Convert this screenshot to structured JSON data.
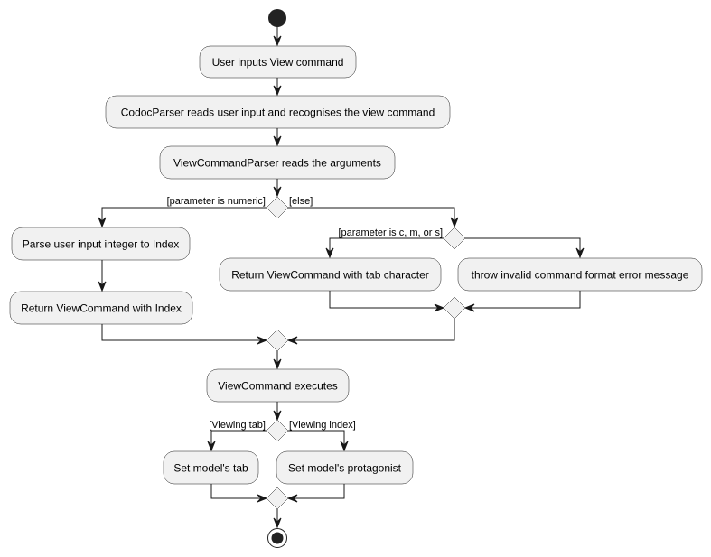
{
  "diagram": {
    "type": "activity",
    "colors": {
      "node_fill": "#F1F1F1",
      "line": "#181818",
      "start_end": "#222222",
      "background": "#FFFFFF"
    },
    "activities": {
      "user_inputs": "User inputs View command",
      "codoc_parser": "CodocParser reads user input and recognises the view command",
      "view_parser": "ViewCommandParser reads the arguments",
      "parse_int": "Parse user input integer to Index",
      "return_index": "Return ViewCommand with Index",
      "return_tab": "Return ViewCommand with tab character",
      "throw_error": "throw invalid command format error message",
      "executes": "ViewCommand executes",
      "set_tab": "Set model's tab",
      "set_protagonist": "Set model's protagonist"
    },
    "guards": {
      "numeric": "[parameter is numeric]",
      "else": "[else]",
      "cms": "[parameter is c, m, or s]",
      "viewing_tab": "[Viewing tab]",
      "viewing_index": "[Viewing index]"
    }
  }
}
